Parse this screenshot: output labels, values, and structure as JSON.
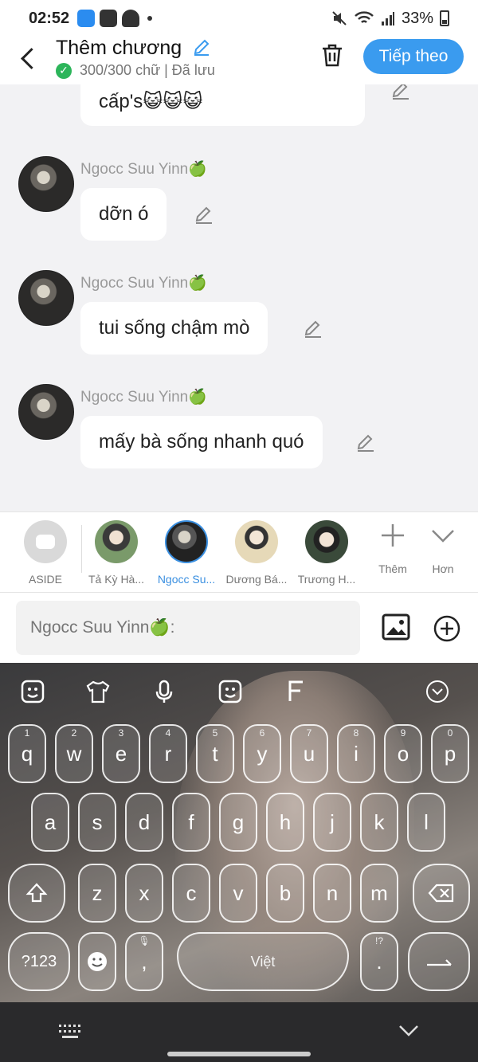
{
  "status_bar": {
    "time": "02:52",
    "battery": "33%"
  },
  "header": {
    "title": "Thêm chương",
    "subtitle": "300/300 chữ | Đã lưu",
    "next_button": "Tiếp theo"
  },
  "messages": [
    {
      "text": "cấp's😺😺😺"
    },
    {
      "author": "Ngocc Suu Yinn🍏",
      "text": "dỡn ó"
    },
    {
      "author": "Ngocc Suu Yinn🍏",
      "text": "tui sống chậm mò"
    },
    {
      "author": "Ngocc Suu Yinn🍏",
      "text": "mấy bà sống nhanh quó"
    }
  ],
  "characters": [
    {
      "label": "ASIDE"
    },
    {
      "label": "Tả Kỳ Hà..."
    },
    {
      "label": "Ngocc Su...",
      "active": true
    },
    {
      "label": "Dương Bá..."
    },
    {
      "label": "Trương H..."
    }
  ],
  "more_actions": {
    "add": "Thêm",
    "more": "Hơn"
  },
  "composer": {
    "placeholder": "Ngocc Suu Yinn🍏:"
  },
  "keyboard": {
    "row1": [
      "q",
      "w",
      "e",
      "r",
      "t",
      "y",
      "u",
      "i",
      "o",
      "p"
    ],
    "row1_hints": [
      "1",
      "2",
      "3",
      "4",
      "5",
      "6",
      "7",
      "8",
      "9",
      "0"
    ],
    "row2": [
      "a",
      "s",
      "d",
      "f",
      "g",
      "h",
      "j",
      "k",
      "l"
    ],
    "row3": [
      "z",
      "x",
      "c",
      "v",
      "b",
      "n",
      "m"
    ],
    "symbols_key": "?123",
    "comma": ",",
    "period": ".",
    "period_hint": "!?",
    "space_label": "Việt"
  },
  "colors": {
    "accent": "#3a9bef",
    "saved_check": "#2cb55a"
  }
}
